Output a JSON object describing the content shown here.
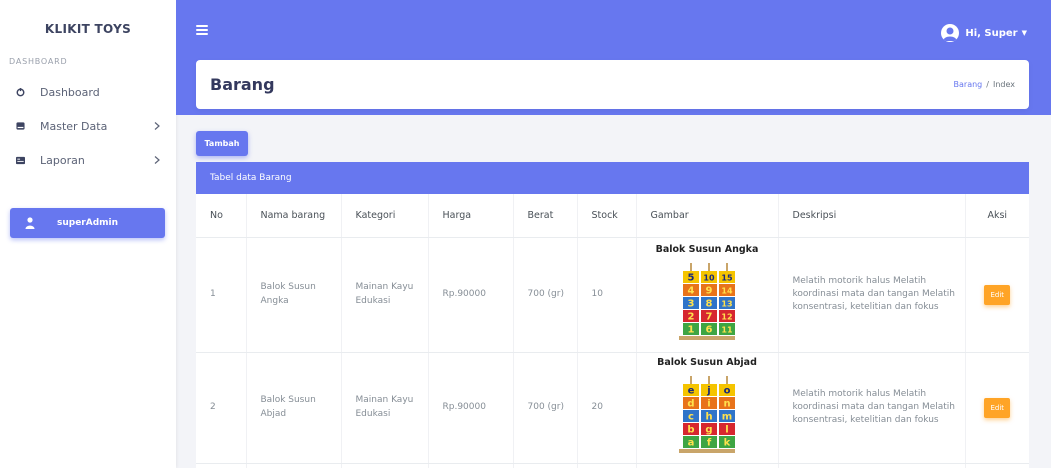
{
  "sidebar": {
    "brand": "KLIKIT TOYS",
    "section": "DASHBOARD",
    "items": [
      {
        "label": "Dashboard"
      },
      {
        "label": "Master Data"
      },
      {
        "label": "Laporan"
      }
    ],
    "user_label": "superAdmin"
  },
  "navbar": {
    "greeting": "Hi, Super"
  },
  "header": {
    "title": "Barang",
    "breadcrumb": [
      "Barang",
      "Index"
    ]
  },
  "actions": {
    "add_label": "Tambah"
  },
  "table": {
    "title": "Tabel data Barang",
    "columns": [
      "No",
      "Nama barang",
      "Kategori",
      "Harga",
      "Berat",
      "Stock",
      "Gambar",
      "Deskripsi",
      "Aksi"
    ],
    "rows": [
      {
        "no": "1",
        "nama": "Balok Susun Angka",
        "kategori": "Mainan Kayu Edukasi",
        "harga": "Rp.90000",
        "berat": "700 (gr)",
        "stock": "10",
        "gambar_title": "Balok Susun Angka",
        "gambar_glyphs": [
          "5",
          "10",
          "15",
          "4",
          "9",
          "14",
          "3",
          "8",
          "13",
          "2",
          "7",
          "12",
          "1",
          "6",
          "11"
        ],
        "deskripsi": "Melatih motorik halus Melatih koordinasi mata dan tangan Melatih konsentrasi, ketelitian dan fokus",
        "aksi": "Edit"
      },
      {
        "no": "2",
        "nama": "Balok Susun Abjad",
        "kategori": "Mainan Kayu Edukasi",
        "harga": "Rp.90000",
        "berat": "700 (gr)",
        "stock": "20",
        "gambar_title": "Balok Susun Abjad",
        "gambar_glyphs": [
          "e",
          "j",
          "o",
          "d",
          "i",
          "n",
          "c",
          "h",
          "m",
          "b",
          "g",
          "l",
          "a",
          "f",
          "k"
        ],
        "deskripsi": "Melatih motorik halus Melatih koordinasi mata dan tangan Melatih konsentrasi, ketelitian dan fokus",
        "aksi": "Edit"
      }
    ]
  },
  "colors": {
    "primary": "#6777ef",
    "warning": "#ffa426",
    "block_rows": [
      "#f5c400",
      "#e8731a",
      "#2f74c9",
      "#d6272f",
      "#3ea543"
    ]
  }
}
